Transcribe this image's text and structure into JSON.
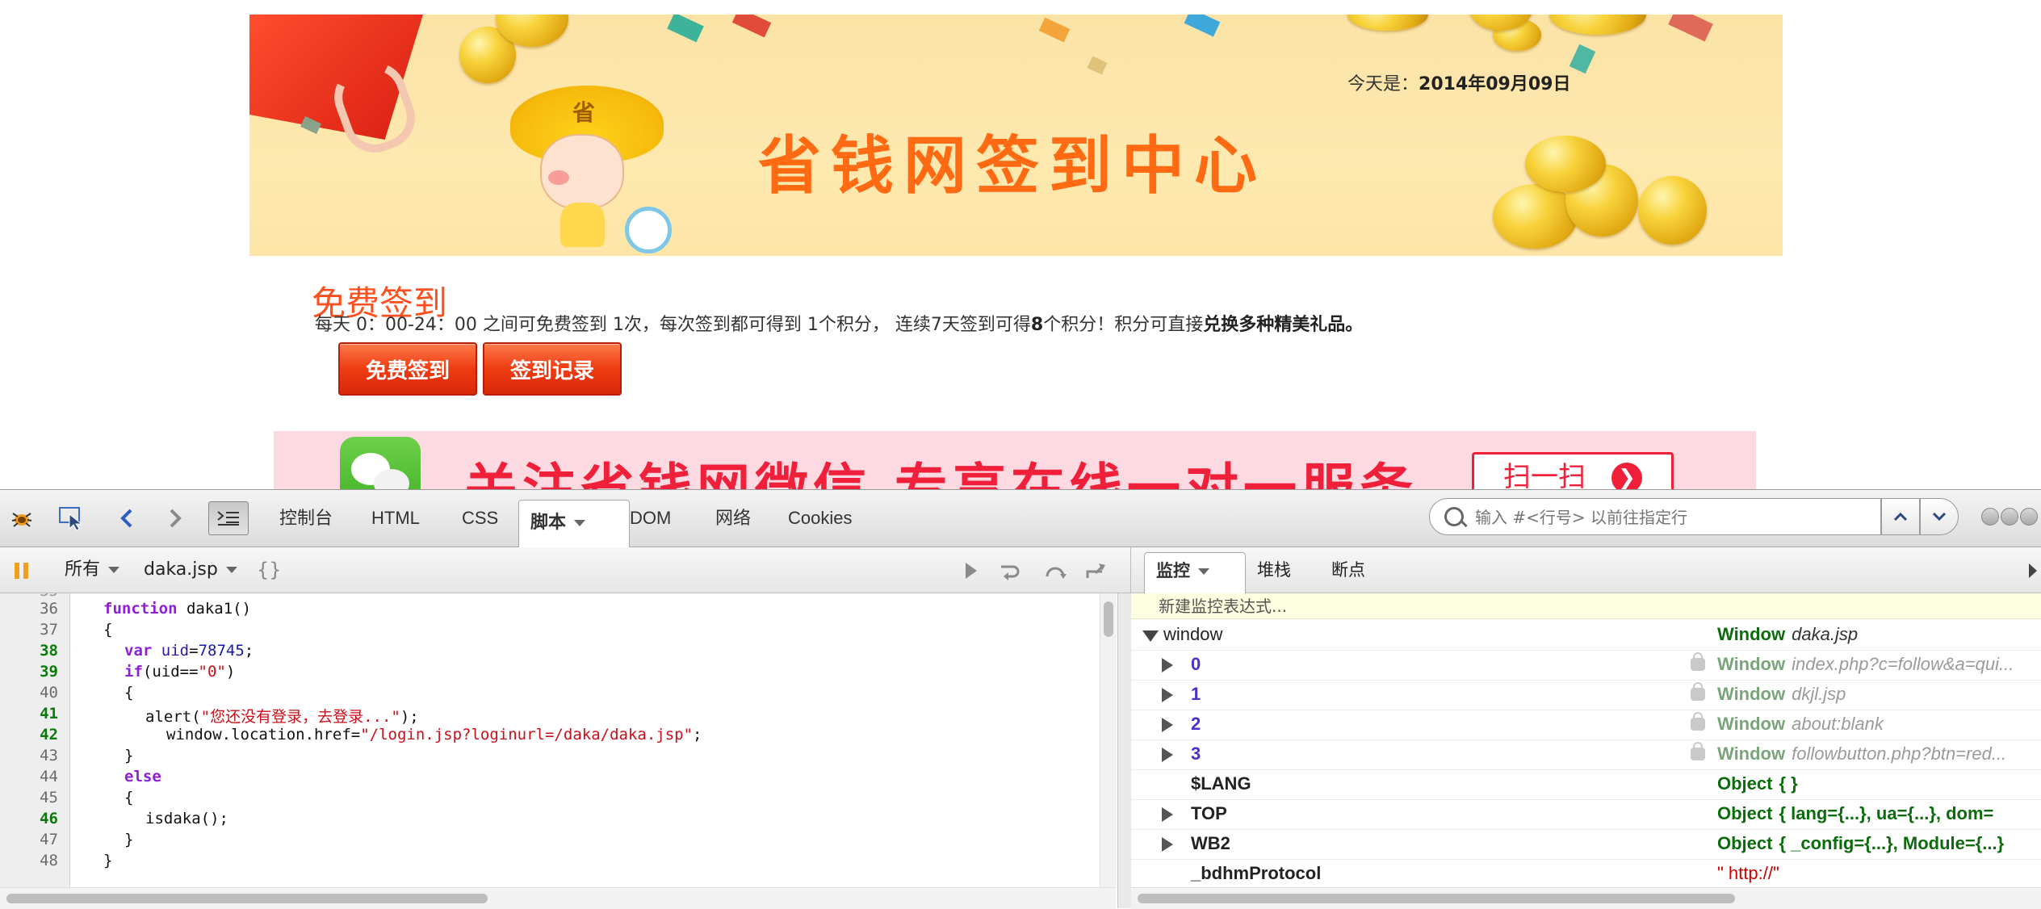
{
  "page": {
    "date_prefix": "今天是：",
    "date_value": "2014年09月09日",
    "banner_title": "省钱网签到中心",
    "mascot_hat_char": "省",
    "free_title": "免费签到",
    "rule_part1": "每天 0：00-24：00 之间可免费签到 1次，每次签到都可得到 1个积分， 连续7天签到可得",
    "rule_bold_num": "8",
    "rule_part2": "个积分！积分可直接",
    "rule_bold_tail": "兑换多种精美礼品。",
    "btn_checkin": "免费签到",
    "btn_records": "签到记录",
    "wechat_text": "关注省钱网微信  专享在线一对一服务",
    "wechat_scan": "扫一扫",
    "wechat_arrow": "❯"
  },
  "firebug": {
    "tabs": [
      {
        "label": "控制台"
      },
      {
        "label": "HTML"
      },
      {
        "label": "CSS"
      },
      {
        "label": "脚本"
      },
      {
        "label": "DOM"
      },
      {
        "label": "网络"
      },
      {
        "label": "Cookies"
      }
    ],
    "search_placeholder": "输入 #<行号> 以前往指定行",
    "filter_all": "所有",
    "file_name": "daka.jsp",
    "pretty_print": "{}",
    "side_tabs": [
      {
        "label": "监控"
      },
      {
        "label": "堆栈"
      },
      {
        "label": "断点"
      }
    ],
    "new_watch": "新建监控表达式...",
    "code": {
      "line_numbers": [
        "36",
        "37",
        "38",
        "39",
        "40",
        "41",
        "42",
        "43",
        "44",
        "45",
        "46",
        "47",
        "48"
      ],
      "exec_lines": [
        "38",
        "39",
        "41",
        "42",
        "46"
      ],
      "l36_kw": "function",
      "l36_rest": " daka1()",
      "l37": "{",
      "l38_kw": "var",
      "l38_name": "uid",
      "l38_eq": "=",
      "l38_num": "78745",
      "l38_end": ";",
      "l39_kw": "if",
      "l39_mid": "(uid==",
      "l39_str": "\"0\"",
      "l39_end": ")",
      "l40": "{",
      "l41_pre": "alert(",
      "l41_str": "\"您还没有登录，去登录...\"",
      "l41_end": ");",
      "l42_pre": "window.location.href=",
      "l42_str": "\"/login.jsp?loginurl=/daka/daka.jsp\"",
      "l42_end": ";",
      "l43": "}",
      "l44_kw": "else",
      "l45": "{",
      "l46": "isdaka();",
      "l47": "}",
      "l48": "}"
    },
    "watch": {
      "root_name": "window",
      "root_type": "Window",
      "root_desc": "daka.jsp",
      "rows": [
        {
          "name": "0",
          "type": "Window",
          "desc": "index.php?c=follow&a=qui..."
        },
        {
          "name": "1",
          "type": "Window",
          "desc": "dkjl.jsp"
        },
        {
          "name": "2",
          "type": "Window",
          "desc": "about:blank"
        },
        {
          "name": "3",
          "type": "Window",
          "desc": "followbutton.php?btn=red..."
        }
      ],
      "lang_name": "$LANG",
      "lang_type": "Object",
      "lang_val": "{  }",
      "top_name": "TOP",
      "top_type": "Object",
      "top_val": "{  lang={...},   ua={...},   dom=",
      "wb2_name": "WB2",
      "wb2_type": "Object",
      "wb2_val": "{  _config={...},   Module={...}",
      "bdhm_name": "_bdhmProtocol",
      "bdhm_val": "\"  http://\""
    }
  }
}
